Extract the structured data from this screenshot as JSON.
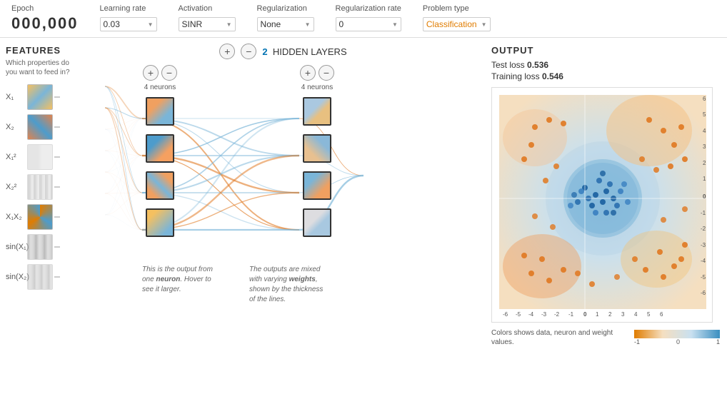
{
  "topbar": {
    "epoch_label": "Epoch",
    "epoch_value": "000,000",
    "learning_rate_label": "Learning rate",
    "learning_rate_value": "0.03",
    "activation_label": "Activation",
    "activation_value": "SINR",
    "regularization_label": "Regularization",
    "regularization_value": "None",
    "reg_rate_label": "Regularization rate",
    "reg_rate_value": "0",
    "problem_type_label": "Problem type",
    "problem_type_value": "Classification"
  },
  "features": {
    "title": "FEATURES",
    "subtitle": "Which properties do you want to feed in?",
    "items": [
      {
        "label": "X₁",
        "class": "feat-x1"
      },
      {
        "label": "X₂",
        "class": "feat-x2"
      },
      {
        "label": "X₁²",
        "class": "feat-x1sq"
      },
      {
        "label": "X₂²",
        "class": "feat-x2sq"
      },
      {
        "label": "X₁X₂",
        "class": "feat-x1x2"
      },
      {
        "label": "sin(X₁)",
        "class": "feat-sinx1"
      },
      {
        "label": "sin(X₂)",
        "class": "feat-sinx2"
      }
    ]
  },
  "network": {
    "plus_label": "+",
    "minus_label": "−",
    "hidden_layers_prefix": "2",
    "hidden_layers_text": "HIDDEN LAYERS",
    "layer1": {
      "neurons": 4,
      "neurons_label": "4 neurons"
    },
    "layer2": {
      "neurons": 4,
      "neurons_label": "4 neurons"
    }
  },
  "annotations": {
    "annotation1": "This is the output from one neuron. Hover to see it larger.",
    "annotation2": "The outputs are mixed with varying weights, shown by the thickness of the lines."
  },
  "output": {
    "title": "OUTPUT",
    "test_loss_label": "Test loss",
    "test_loss_value": "0.536",
    "training_loss_label": "Training loss",
    "training_loss_value": "0.546",
    "colorbar_label": "Colors shows data, neuron and weight values.",
    "colorbar_ticks": [
      "-1",
      "0",
      "1"
    ]
  },
  "chart": {
    "axis_ticks_x": [
      "-6",
      "-5",
      "-4",
      "-3",
      "-2",
      "-1",
      "0",
      "1",
      "2",
      "3",
      "4",
      "5",
      "6"
    ],
    "axis_ticks_y": [
      "6",
      "5",
      "4",
      "3",
      "2",
      "1",
      "0",
      "-1",
      "-2",
      "-3",
      "-4",
      "-5",
      "-6"
    ]
  }
}
